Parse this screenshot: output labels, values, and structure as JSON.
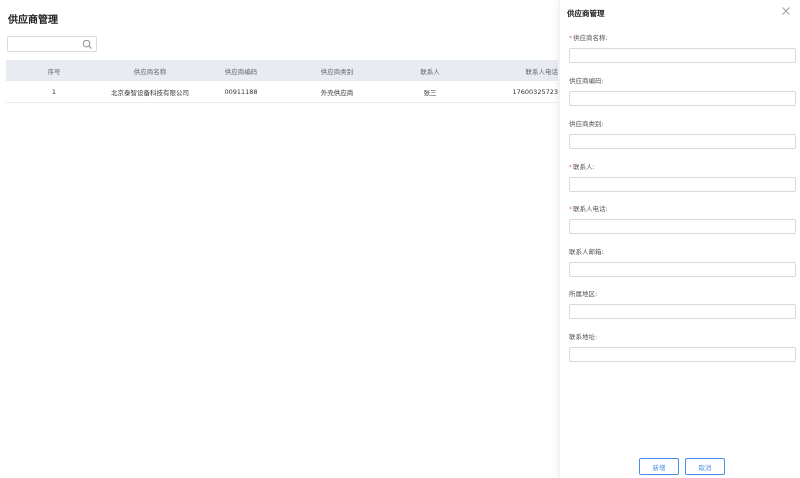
{
  "page": {
    "title": "供应商管理"
  },
  "search": {
    "value": "",
    "placeholder": ""
  },
  "table": {
    "headers": [
      "序号",
      "供应商名称",
      "供应商编码",
      "供应商类别",
      "联系人",
      "联系人电话"
    ],
    "rows": [
      [
        "1",
        "北京泰智设备科技有限公司",
        "00911188",
        "外壳供应商",
        "张三",
        "17600325723"
      ]
    ]
  },
  "drawer": {
    "title": "供应商管理",
    "fields": [
      {
        "label": "供应商名称:",
        "required": true,
        "value": ""
      },
      {
        "label": "供应商编码:",
        "required": false,
        "value": ""
      },
      {
        "label": "供应商类别:",
        "required": false,
        "value": ""
      },
      {
        "label": "联系人:",
        "required": true,
        "value": ""
      },
      {
        "label": "联系人电话:",
        "required": true,
        "value": ""
      },
      {
        "label": "联系人邮箱:",
        "required": false,
        "value": ""
      },
      {
        "label": "所属地区:",
        "required": false,
        "value": ""
      },
      {
        "label": "联系地址:",
        "required": false,
        "value": ""
      }
    ],
    "buttons": {
      "add": "新增",
      "cancel": "取消"
    },
    "required_mark": "*"
  },
  "icons": {
    "search": "search-icon",
    "close": "close-icon"
  },
  "colors": {
    "accent": "#4a90e2",
    "header_bg": "#e8ecf2",
    "required": "#f56c6c"
  }
}
